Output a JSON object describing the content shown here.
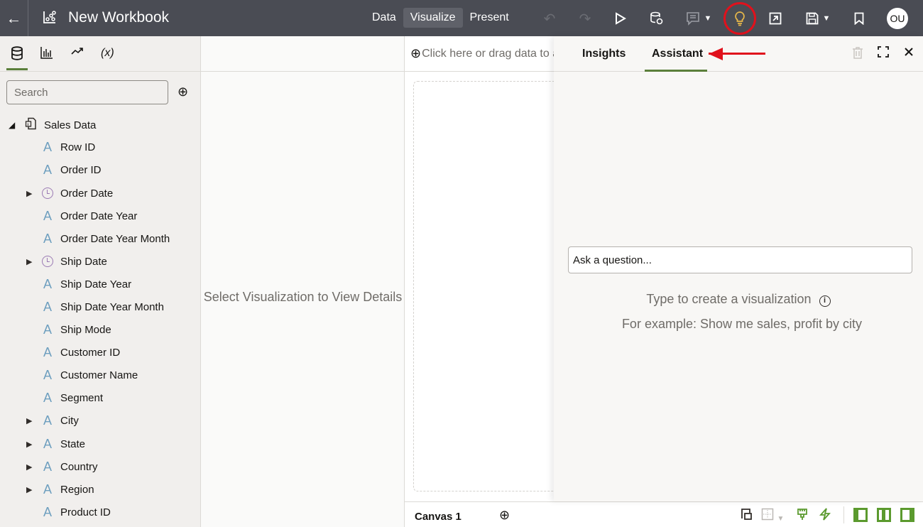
{
  "header": {
    "back_icon": "arrow-left-icon",
    "logo_icon": "workbook-chart-icon",
    "title": "New Workbook",
    "modes": [
      {
        "label": "Data",
        "active": false
      },
      {
        "label": "Visualize",
        "active": true
      },
      {
        "label": "Present",
        "active": false
      }
    ],
    "toolbar_icons": [
      "undo-icon",
      "redo-icon",
      "play-icon",
      "refresh-data-icon",
      "comment-icon",
      "lightbulb-icon",
      "export-icon",
      "save-icon",
      "bookmark-icon"
    ],
    "avatar_initials": "OU",
    "highlight_color": "#e0111c",
    "insights_color": "#e8b84a"
  },
  "left_panel": {
    "tabs": [
      "data-icon",
      "visualizations-icon",
      "analytics-icon",
      "calculations-icon"
    ],
    "calc_tab_label": "(x)",
    "search_placeholder": "Search",
    "dataset": "Sales Data",
    "fields": [
      {
        "label": "Row ID",
        "type": "attribute",
        "expandable": false
      },
      {
        "label": "Order ID",
        "type": "attribute",
        "expandable": false
      },
      {
        "label": "Order Date",
        "type": "date",
        "expandable": true
      },
      {
        "label": "Order Date Year",
        "type": "attribute",
        "expandable": false
      },
      {
        "label": "Order Date Year Month",
        "type": "attribute",
        "expandable": false
      },
      {
        "label": "Ship Date",
        "type": "date",
        "expandable": true
      },
      {
        "label": "Ship Date Year",
        "type": "attribute",
        "expandable": false
      },
      {
        "label": "Ship Date Year Month",
        "type": "attribute",
        "expandable": false
      },
      {
        "label": "Ship Mode",
        "type": "attribute",
        "expandable": false
      },
      {
        "label": "Customer ID",
        "type": "attribute",
        "expandable": false
      },
      {
        "label": "Customer Name",
        "type": "attribute",
        "expandable": false
      },
      {
        "label": "Segment",
        "type": "attribute",
        "expandable": false
      },
      {
        "label": "City",
        "type": "attribute",
        "expandable": true
      },
      {
        "label": "State",
        "type": "attribute",
        "expandable": true
      },
      {
        "label": "Country",
        "type": "attribute",
        "expandable": true
      },
      {
        "label": "Region",
        "type": "attribute",
        "expandable": true
      },
      {
        "label": "Product ID",
        "type": "attribute",
        "expandable": false
      }
    ]
  },
  "middle_panel": {
    "message": "Select Visualization to View Details"
  },
  "canvas": {
    "drop_hint": "Click here or drag data to a",
    "tab_label": "Canvas 1"
  },
  "assistant_panel": {
    "tabs": [
      {
        "label": "Insights",
        "active": false
      },
      {
        "label": "Assistant",
        "active": true
      }
    ],
    "question_placeholder": "Ask a question...",
    "hint_line1": "Type to create a visualization",
    "hint_line2": "For example: Show me sales, profit by city"
  },
  "bottom_toolbar": {
    "accent_color": "#5b9a2e"
  }
}
